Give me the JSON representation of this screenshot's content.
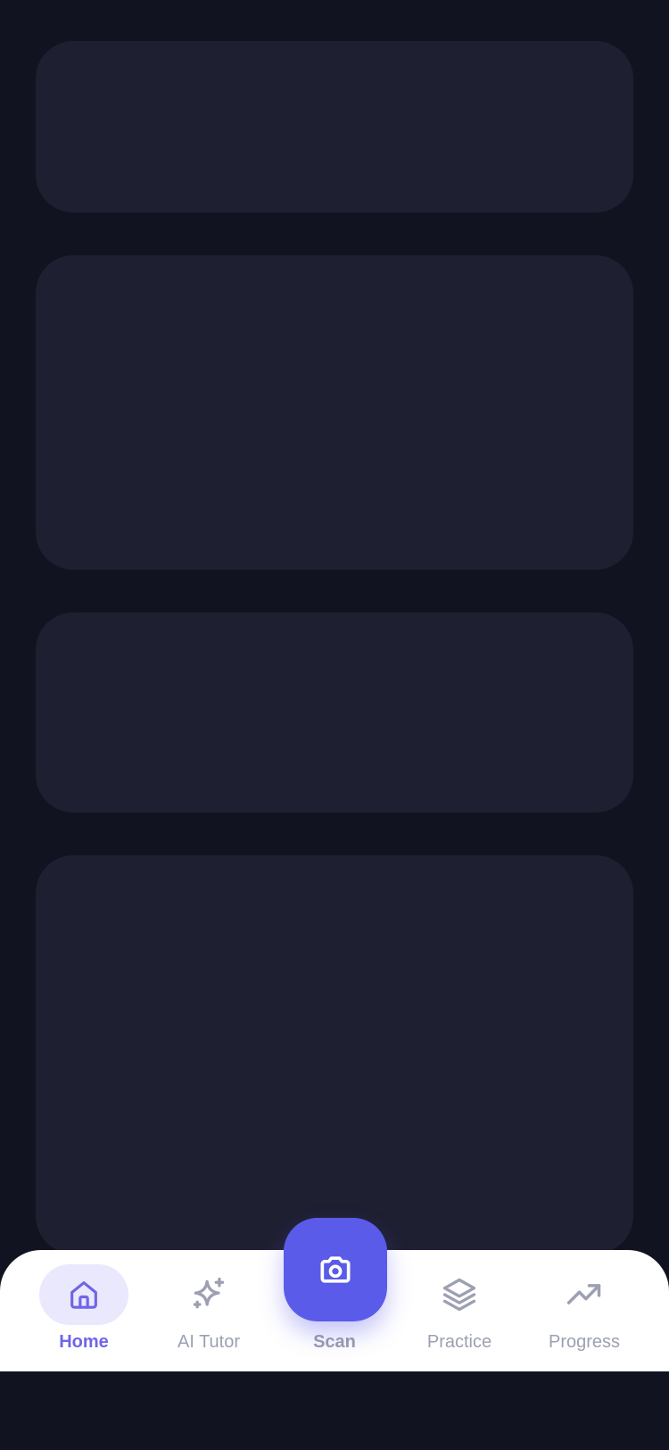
{
  "colors": {
    "background": "#111320",
    "card": "#1E1F31",
    "tabbar": "#FFFFFF",
    "accent": "#5B5BEA",
    "active_tab": "#6E66E6",
    "inactive_tab": "#9CA0B2"
  },
  "cards": [
    {
      "name": "placeholder-card-1"
    },
    {
      "name": "placeholder-card-2"
    },
    {
      "name": "placeholder-card-3"
    },
    {
      "name": "placeholder-card-4"
    }
  ],
  "nav": {
    "active": "Home",
    "items": [
      {
        "label": "Home",
        "icon": "home-icon",
        "active": true
      },
      {
        "label": "AI Tutor",
        "icon": "sparkles-icon",
        "active": false
      },
      {
        "label": "Scan",
        "icon": "camera-icon",
        "active": false
      },
      {
        "label": "Practice",
        "icon": "layers-icon",
        "active": false
      },
      {
        "label": "Progress",
        "icon": "trending-up-icon",
        "active": false
      }
    ]
  }
}
